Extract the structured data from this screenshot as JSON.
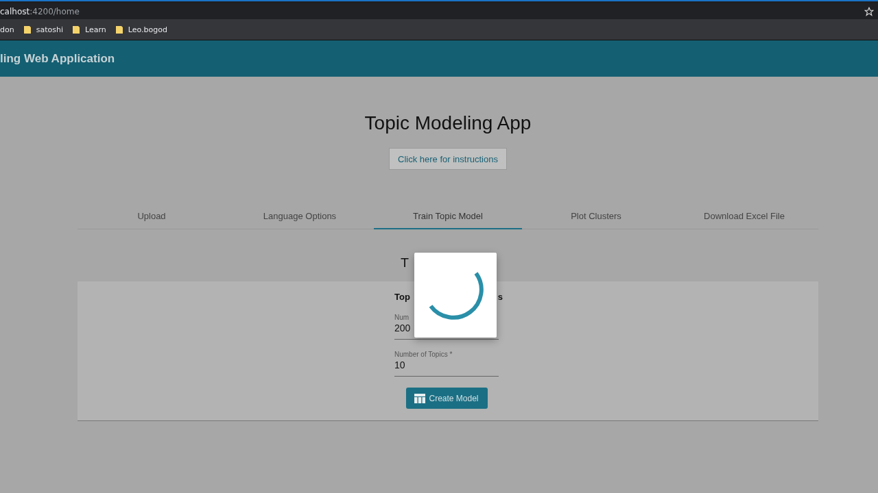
{
  "browser": {
    "address": {
      "host": "calhost",
      "path": ":4200/home"
    },
    "bookmarks": [
      {
        "label": "don",
        "kind": "plain"
      },
      {
        "label": "satoshi",
        "kind": "folder"
      },
      {
        "label": "Learn",
        "kind": "folder"
      },
      {
        "label": "Leo.bogod",
        "kind": "folder"
      }
    ]
  },
  "toolbar": {
    "title": "ling Web Application"
  },
  "page": {
    "title": "Topic Modeling App",
    "instructions_button": "Click here for instructions"
  },
  "tabs": [
    {
      "label": "Upload",
      "selected": false
    },
    {
      "label": "Language Options",
      "selected": false
    },
    {
      "label": "Train Topic Model",
      "selected": true
    },
    {
      "label": "Plot Clusters",
      "selected": false
    },
    {
      "label": "Download Excel File",
      "selected": false
    }
  ],
  "section_heading": "T",
  "card": {
    "heading_start": "Top",
    "heading_end": "s",
    "fields": [
      {
        "label": "Num",
        "value": "200"
      },
      {
        "label": "Number of Topics *",
        "value": "10"
      }
    ],
    "button": "Create Model"
  },
  "dialog": {
    "kind": "spinner"
  }
}
